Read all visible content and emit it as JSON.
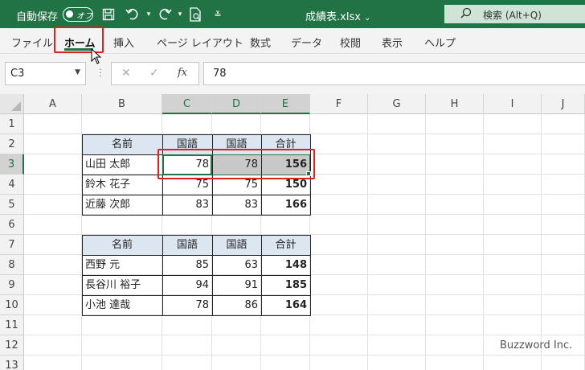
{
  "titlebar": {
    "autosave_label": "自動保存",
    "autosave_state": "オフ",
    "document_title": "成績表.xlsx",
    "search_placeholder": "検索 (Alt+Q)"
  },
  "ribbon": {
    "tabs": [
      {
        "label": "ファイル"
      },
      {
        "label": "ホーム",
        "active": true
      },
      {
        "label": "挿入"
      },
      {
        "label": "ページ レイアウト"
      },
      {
        "label": "数式"
      },
      {
        "label": "データ"
      },
      {
        "label": "校閲"
      },
      {
        "label": "表示"
      },
      {
        "label": "ヘルプ"
      }
    ]
  },
  "formula_bar": {
    "name_box": "C3",
    "fx_label": "fx",
    "value": "78"
  },
  "grid": {
    "columns": [
      "A",
      "B",
      "C",
      "D",
      "E",
      "F",
      "G",
      "H",
      "I",
      "J"
    ],
    "rows": [
      "1",
      "2",
      "3",
      "4",
      "5",
      "6",
      "7",
      "8",
      "9",
      "10",
      "11",
      "12",
      "13"
    ],
    "selected_cell": "C3",
    "selected_range": "C3:E3"
  },
  "table1": {
    "headers": [
      "名前",
      "国語",
      "国語",
      "合計"
    ],
    "rows": [
      [
        "山田 太郎",
        "78",
        "78",
        "156"
      ],
      [
        "鈴木 花子",
        "75",
        "75",
        "150"
      ],
      [
        "近藤 次郎",
        "83",
        "83",
        "166"
      ]
    ]
  },
  "table2": {
    "headers": [
      "名前",
      "国語",
      "国語",
      "合計"
    ],
    "rows": [
      [
        "西野 元",
        "85",
        "63",
        "148"
      ],
      [
        "長谷川 裕子",
        "94",
        "91",
        "185"
      ],
      [
        "小池 達哉",
        "78",
        "86",
        "164"
      ]
    ]
  },
  "watermark": "Buzzword Inc.",
  "colors": {
    "excel_green": "#217346",
    "highlight_red": "#e0201c",
    "table_header_fill": "#dce6f0",
    "selection_fill": "#c8c8c8"
  }
}
